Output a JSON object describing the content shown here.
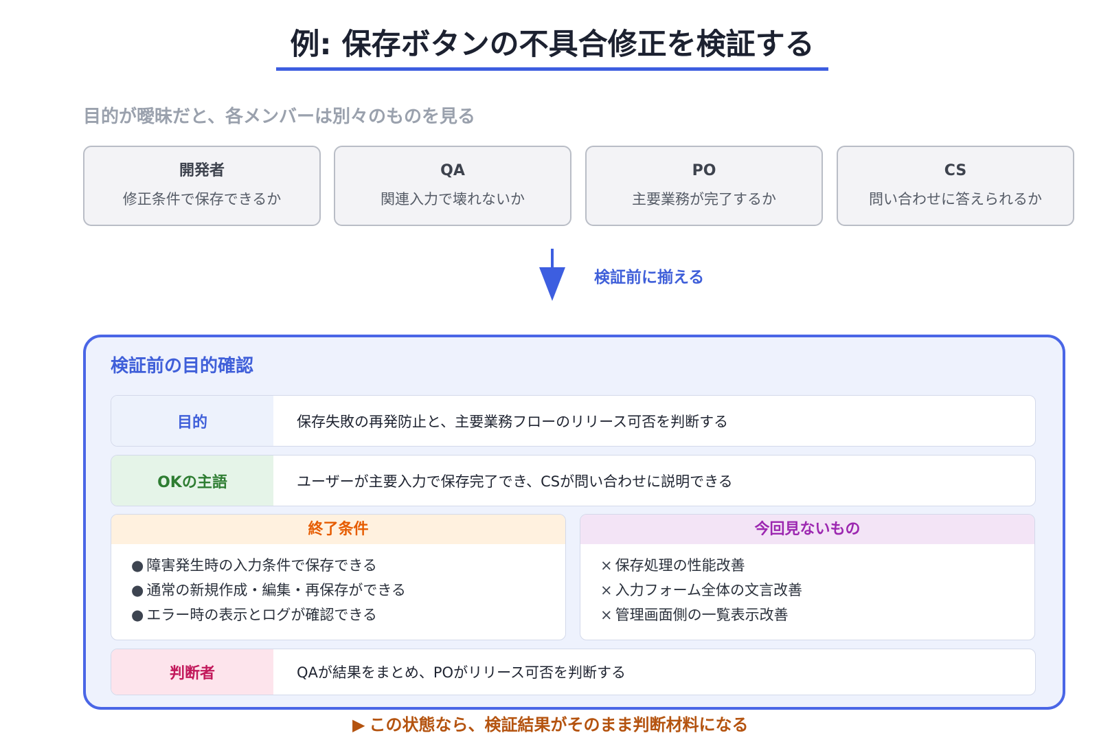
{
  "title": "例: 保存ボタンの不具合修正を検証する",
  "subtitle": "目的が曖昧だと、各メンバーは別々のものを見る",
  "roles": [
    {
      "name": "開発者",
      "view": "修正条件で保存できるか"
    },
    {
      "name": "QA",
      "view": "関連入力で壊れないか"
    },
    {
      "name": "PO",
      "view": "主要業務が完了するか"
    },
    {
      "name": "CS",
      "view": "問い合わせに答えられるか"
    }
  ],
  "arrow": {
    "icon": "down-arrow-icon",
    "label": "検証前に揃える"
  },
  "panel": {
    "heading": "検証前の目的確認",
    "purpose": {
      "label": "目的",
      "text": "保存失敗の再発防止と、主要業務フローのリリース可否を判断する"
    },
    "ok_subject": {
      "label": "OKの主語",
      "text": "ユーザーが主要入力で保存完了でき、CSが問い合わせに説明できる"
    },
    "exit_criteria": {
      "label": "終了条件",
      "marker": "●",
      "items": [
        "障害発生時の入力条件で保存できる",
        "通常の新規作成・編集・再保存ができる",
        "エラー時の表示とログが確認できる"
      ]
    },
    "out_of_scope": {
      "label": "今回見ないもの",
      "marker": "×",
      "items": [
        "保存処理の性能改善",
        "入力フォーム全体の文言改善",
        "管理画面側の一覧表示改善"
      ]
    },
    "decider": {
      "label": "判断者",
      "text": "QAが結果をまとめ、POがリリース可否を判断する"
    }
  },
  "footer": {
    "marker": "▶",
    "text": "この状態なら、検証結果がそのまま判断材料になる"
  },
  "colors": {
    "accent_blue": "#3d5ee0",
    "panel_border": "#4a66e6",
    "panel_bg": "#eef2fd",
    "role_card_bg": "#f3f3f6",
    "ok_green": "#2e7d32",
    "exit_orange": "#e65c00",
    "out_purple": "#9c27b0",
    "decider_pink": "#c2185b",
    "footer_brown": "#b4530f"
  }
}
